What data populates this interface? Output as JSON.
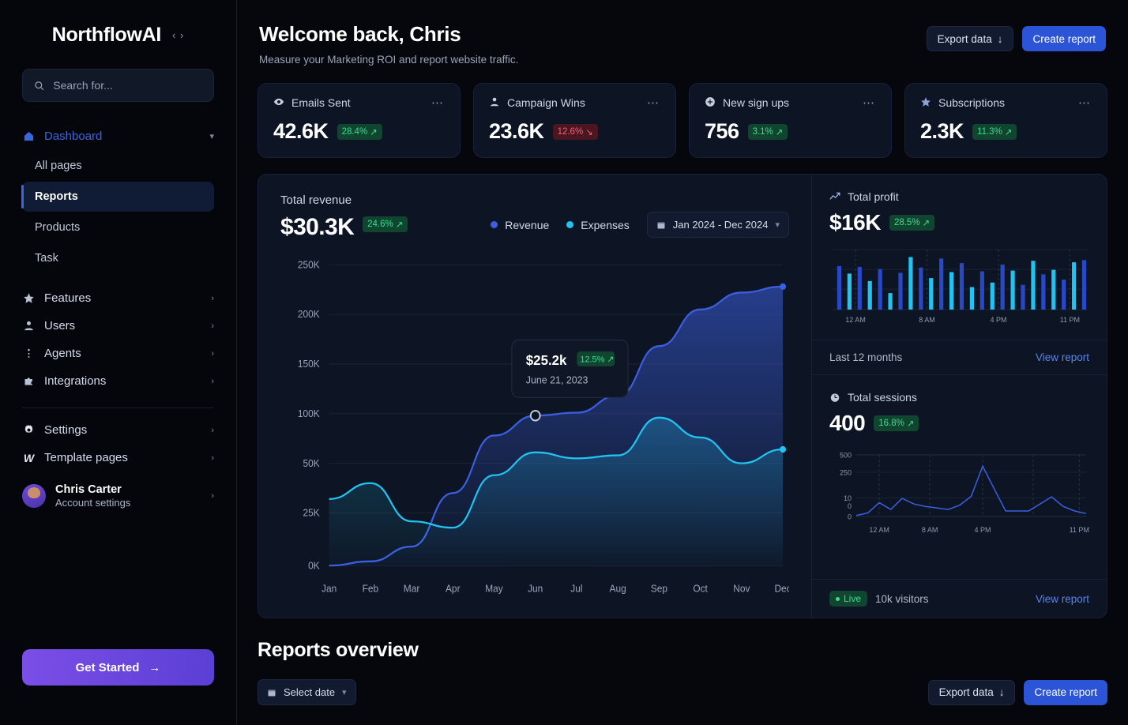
{
  "brand": {
    "name": "NorthflowAI",
    "collapse_icon": "chevrons-icon"
  },
  "search": {
    "placeholder": "Search for...",
    "value": "",
    "icon": "search-icon"
  },
  "sidebar": {
    "dashboard": {
      "label": "Dashboard",
      "icon": "home-icon",
      "chevron": "chevron-down-icon"
    },
    "sub_items": [
      {
        "label": "All pages",
        "active": false
      },
      {
        "label": "Reports",
        "active": true
      },
      {
        "label": "Products",
        "active": false
      },
      {
        "label": "Task",
        "active": false
      }
    ],
    "groups": [
      {
        "label": "Features",
        "icon": "star-icon",
        "chevron": "chevron-right-icon"
      },
      {
        "label": "Users",
        "icon": "user-icon",
        "chevron": "chevron-right-icon"
      },
      {
        "label": "Agents",
        "icon": "agents-icon",
        "chevron": "chevron-right-icon"
      },
      {
        "label": "Integrations",
        "icon": "puzzle-icon",
        "chevron": "chevron-right-icon"
      }
    ],
    "footer_groups": [
      {
        "label": "Settings",
        "icon": "gear-icon",
        "chevron": "chevron-right-icon"
      },
      {
        "label": "Template pages",
        "icon": "w-logo-icon",
        "chevron": "chevron-right-icon"
      }
    ],
    "user": {
      "name": "Chris Carter",
      "subtitle": "Account settings",
      "chevron": "chevron-right-icon"
    },
    "cta": {
      "label": "Get Started",
      "icon": "arrow-right-icon"
    }
  },
  "header": {
    "title": "Welcome back, Chris",
    "subtitle": "Measure your Marketing ROI and report website traffic.",
    "export_label": "Export data",
    "export_icon": "download-icon",
    "create_label": "Create report"
  },
  "kpis": [
    {
      "label": "Emails Sent",
      "icon": "eye-icon",
      "value": "42.6K",
      "delta": "28.4%",
      "direction": "up",
      "menu_icon": "more-icon"
    },
    {
      "label": "Campaign Wins",
      "icon": "user-icon",
      "value": "23.6K",
      "delta": "12.6%",
      "direction": "down",
      "menu_icon": "more-icon"
    },
    {
      "label": "New sign ups",
      "icon": "plus-circle-icon",
      "value": "756",
      "delta": "3.1%",
      "direction": "up",
      "menu_icon": "more-icon"
    },
    {
      "label": "Subscriptions",
      "icon": "star-icon",
      "value": "2.3K",
      "delta": "11.3%",
      "direction": "up",
      "menu_icon": "more-icon"
    }
  ],
  "revenue_panel": {
    "label": "Total revenue",
    "value": "$30.3K",
    "delta": "24.6%",
    "direction": "up",
    "legend": [
      {
        "name": "Revenue",
        "color": "#3b5fe0"
      },
      {
        "name": "Expenses",
        "color": "#22c3f0"
      }
    ],
    "date_range": "Jan 2024 - Dec 2024",
    "date_icon": "calendar-icon",
    "date_chevron": "chevron-down-icon",
    "tooltip": {
      "value": "$25.2k",
      "delta": "12.5%",
      "direction": "up",
      "date": "June 21, 2023"
    }
  },
  "profit_card": {
    "title": "Total profit",
    "icon": "trend-up-icon",
    "value": "$16K",
    "delta": "28.5%",
    "direction": "up",
    "footer_text": "Last 12 months",
    "view_report": "View report"
  },
  "sessions_card": {
    "title": "Total sessions",
    "icon": "clock-icon",
    "value": "400",
    "delta": "16.8%",
    "direction": "up",
    "live_label": "Live",
    "visitors": "10k visitors",
    "view_report": "View report"
  },
  "reports_section": {
    "title": "Reports overview",
    "select_date_label": "Select date",
    "select_date_icon": "calendar-icon",
    "select_date_chevron": "chevron-down-icon",
    "export_label": "Export data",
    "export_icon": "download-icon",
    "create_label": "Create report"
  },
  "colors": {
    "accent_blue": "#2b55d6",
    "revenue_line": "#3b5fe0",
    "expenses_line": "#22c3f0",
    "up_green": "#3ddc92",
    "down_red": "#f0607a",
    "cta_purple": "#6b45e0",
    "card_bg": "#0d1524",
    "page_bg": "#05070d"
  },
  "chart_data": [
    {
      "type": "area",
      "title": "Total revenue",
      "id": "revenue-chart",
      "categories": [
        "Jan",
        "Feb",
        "Mar",
        "Apr",
        "May",
        "Jun",
        "Jul",
        "Aug",
        "Sep",
        "Oct",
        "Nov",
        "Dec"
      ],
      "ytick_labels": [
        "250K",
        "200K",
        "150K",
        "100K",
        "50K",
        "25K",
        "0K"
      ],
      "ytick_values": [
        250000,
        200000,
        150000,
        100000,
        50000,
        25000,
        0
      ],
      "ylim": [
        0,
        265000
      ],
      "grid": true,
      "legend_position": "top-right",
      "xlabel": "",
      "ylabel": "",
      "series": [
        {
          "name": "Revenue",
          "color": "#3b5fe0",
          "values": [
            0,
            2000,
            9000,
            35000,
            78000,
            98000,
            101000,
            118000,
            168000,
            205000,
            222000,
            228000
          ]
        },
        {
          "name": "Expenses",
          "color": "#22c3f0",
          "values": [
            32000,
            40000,
            21000,
            18000,
            44000,
            61000,
            55000,
            58000,
            96000,
            76000,
            50000,
            64000
          ]
        }
      ],
      "annotation": {
        "label": "$25.2k",
        "delta": "12.5%",
        "date": "June 21, 2023",
        "series": "Revenue",
        "x": "Jun"
      }
    },
    {
      "type": "bar",
      "title": "Total profit",
      "id": "profit-chart",
      "xtick_labels": [
        "12 AM",
        "8 AM",
        "4 PM",
        "11 PM"
      ],
      "categories": [
        "0",
        "1",
        "2",
        "3",
        "4",
        "5",
        "6",
        "7",
        "8",
        "9",
        "10",
        "11",
        "12",
        "13",
        "14",
        "15",
        "16",
        "17",
        "18",
        "19",
        "20",
        "21",
        "22",
        "23"
      ],
      "values": [
        58,
        48,
        57,
        38,
        54,
        22,
        49,
        70,
        56,
        42,
        68,
        50,
        62,
        30,
        51,
        36,
        60,
        52,
        33,
        65,
        47,
        53,
        40,
        63,
        66
      ],
      "colors": [
        "#2848c8",
        "#22c3f0"
      ],
      "grid": true,
      "ylim": [
        0,
        80
      ]
    },
    {
      "type": "line",
      "title": "Total sessions",
      "id": "sessions-chart",
      "xtick_labels": [
        "12 AM",
        "8 AM",
        "4 PM",
        "11 PM"
      ],
      "ytick_labels": [
        "500",
        "250",
        "10",
        "0",
        "0"
      ],
      "ytick_values": [
        500,
        250,
        10,
        0,
        0
      ],
      "color": "#3b5fe0",
      "grid": true,
      "values": [
        4,
        14,
        55,
        28,
        72,
        50,
        40,
        34,
        28,
        45,
        80,
        200,
        110,
        22,
        22,
        22,
        50,
        78,
        40,
        22,
        12
      ]
    }
  ]
}
